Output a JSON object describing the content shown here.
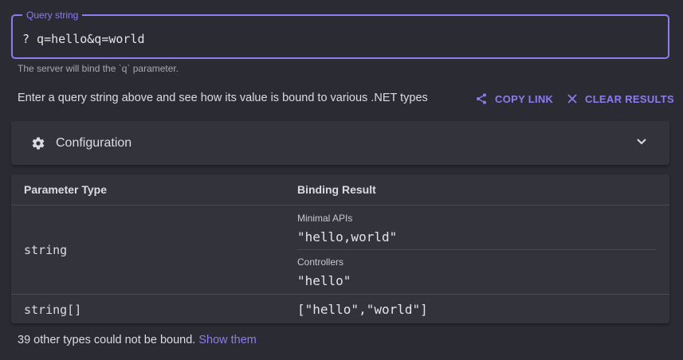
{
  "query": {
    "legend": "Query string",
    "value": "? q=hello&q=world",
    "helper": "The server will bind the `q` parameter."
  },
  "intro": "Enter a query string above and see how its value is bound to various .NET types",
  "actions": {
    "copy_link": "COPY LINK",
    "clear_results": "CLEAR RESULTS"
  },
  "configuration": {
    "title": "Configuration"
  },
  "table": {
    "headers": [
      "Parameter Type",
      "Binding Result"
    ],
    "rows": [
      {
        "type": "string",
        "results": [
          {
            "label": "Minimal APIs",
            "value": "\"hello,world\""
          },
          {
            "label": "Controllers",
            "value": "\"hello\""
          }
        ]
      },
      {
        "type": "string[]",
        "result": "[\"hello\",\"world\"]"
      }
    ]
  },
  "footer": {
    "text": "39 other types could not be bound.",
    "link": "Show them"
  },
  "colors": {
    "accent": "#8b7cf0",
    "background": "#2b2b33",
    "surface": "#33333c"
  }
}
